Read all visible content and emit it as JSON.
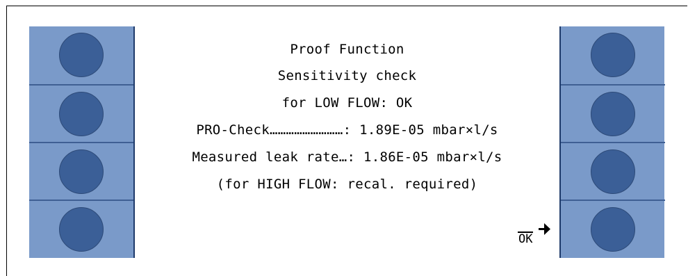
{
  "screen": {
    "lines": [
      "Proof Function",
      "Sensitivity check",
      "for LOW FLOW: OK",
      "PRO-Check………………………: 1.89E-05 mbar×l/s",
      "Measured leak rate…: 1.86E-05 mbar×l/s",
      "(for HIGH FLOW: recal. required)"
    ],
    "ok_label": "OK"
  },
  "icons": {
    "ok_arrow": "arrow-right-icon",
    "softkey": "circle-button-icon"
  },
  "colors": {
    "panel_blue": "#7a9ac9",
    "button_blue": "#3b5f97",
    "divider_blue": "#3f5f93",
    "screen_bg": "#ffffff"
  }
}
